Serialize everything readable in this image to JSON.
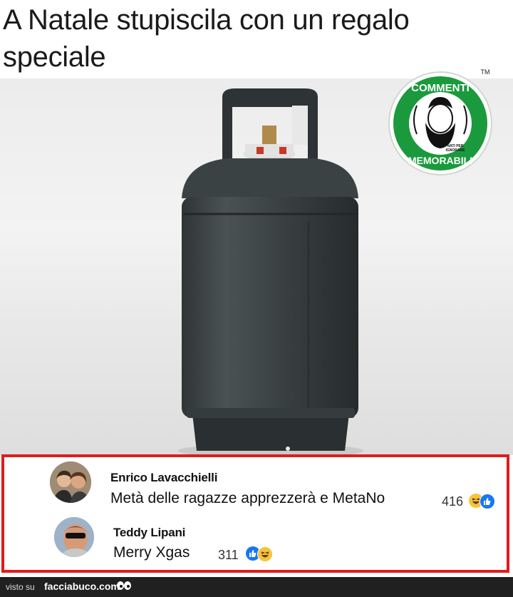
{
  "post": {
    "caption_line1": "A Natale stupiscila con un regalo",
    "caption_line2": "speciale"
  },
  "logo": {
    "text_top": "COMMENTI",
    "text_bottom": "MEMORABILI",
    "tagline_1": "NATI PER",
    "tagline_2": "IGNORARE",
    "trademark": "TM",
    "ring_color": "#1a9a3c"
  },
  "comments": [
    {
      "author": "Enrico Lavacchielli",
      "text": "Metà delle ragazze apprezzerà e MetaNo",
      "reaction_count": "416",
      "reactions": [
        "haha-icon",
        "like-icon"
      ]
    },
    {
      "author": "Teddy Lipani",
      "text": "Merry Xgas",
      "reaction_count": "311",
      "reactions": [
        "like-icon",
        "haha-icon"
      ]
    }
  ],
  "footer": {
    "visto_label": "visto su",
    "site": "facciabuco.com"
  },
  "colors": {
    "highlight_border": "#e11b1b",
    "like_blue": "#1877f2",
    "haha_yellow": "#f7c33b"
  }
}
